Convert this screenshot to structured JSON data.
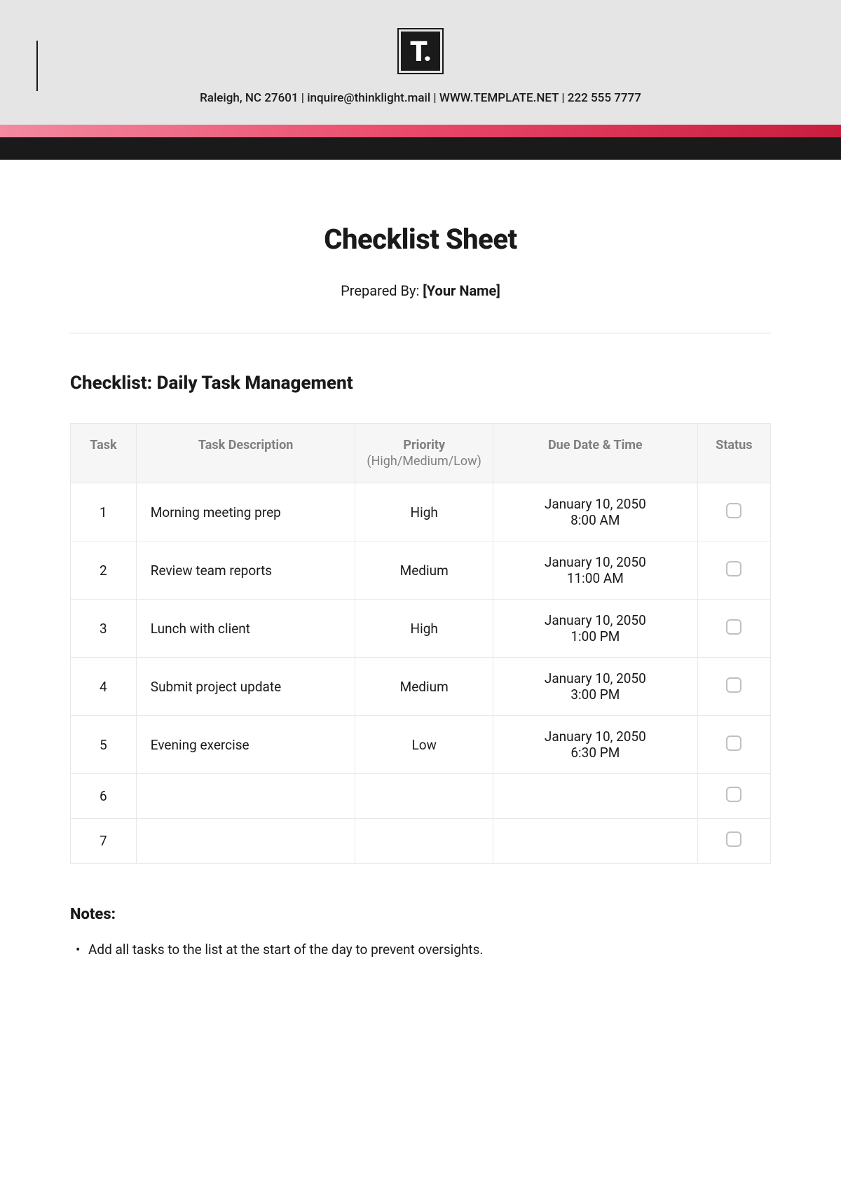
{
  "header": {
    "logo_text": "T.",
    "contact_line": "Raleigh, NC 27601 | inquire@thinklight.mail | WWW.TEMPLATE.NET | 222 555 7777"
  },
  "title": "Checklist Sheet",
  "prepared_by_label": "Prepared By: ",
  "prepared_by_value": "[Your Name]",
  "section_title": "Checklist: Daily Task Management",
  "table": {
    "headers": {
      "task": "Task",
      "description": "Task Description",
      "priority": "Priority",
      "priority_sub": "(High/Medium/Low)",
      "due": "Due Date & Time",
      "status": "Status"
    },
    "rows": [
      {
        "num": "1",
        "desc": "Morning meeting prep",
        "priority": "High",
        "due_date": "January 10, 2050",
        "due_time": "8:00 AM"
      },
      {
        "num": "2",
        "desc": "Review team reports",
        "priority": "Medium",
        "due_date": "January 10, 2050",
        "due_time": "11:00 AM"
      },
      {
        "num": "3",
        "desc": "Lunch with client",
        "priority": "High",
        "due_date": "January 10, 2050",
        "due_time": "1:00 PM"
      },
      {
        "num": "4",
        "desc": "Submit project update",
        "priority": "Medium",
        "due_date": "January 10, 2050",
        "due_time": "3:00 PM"
      },
      {
        "num": "5",
        "desc": "Evening exercise",
        "priority": "Low",
        "due_date": "January 10, 2050",
        "due_time": "6:30 PM"
      },
      {
        "num": "6",
        "desc": "",
        "priority": "",
        "due_date": "",
        "due_time": ""
      },
      {
        "num": "7",
        "desc": "",
        "priority": "",
        "due_date": "",
        "due_time": ""
      }
    ]
  },
  "notes": {
    "heading": "Notes:",
    "items": [
      "Add all tasks to the list at the start of the day to prevent oversights."
    ]
  }
}
